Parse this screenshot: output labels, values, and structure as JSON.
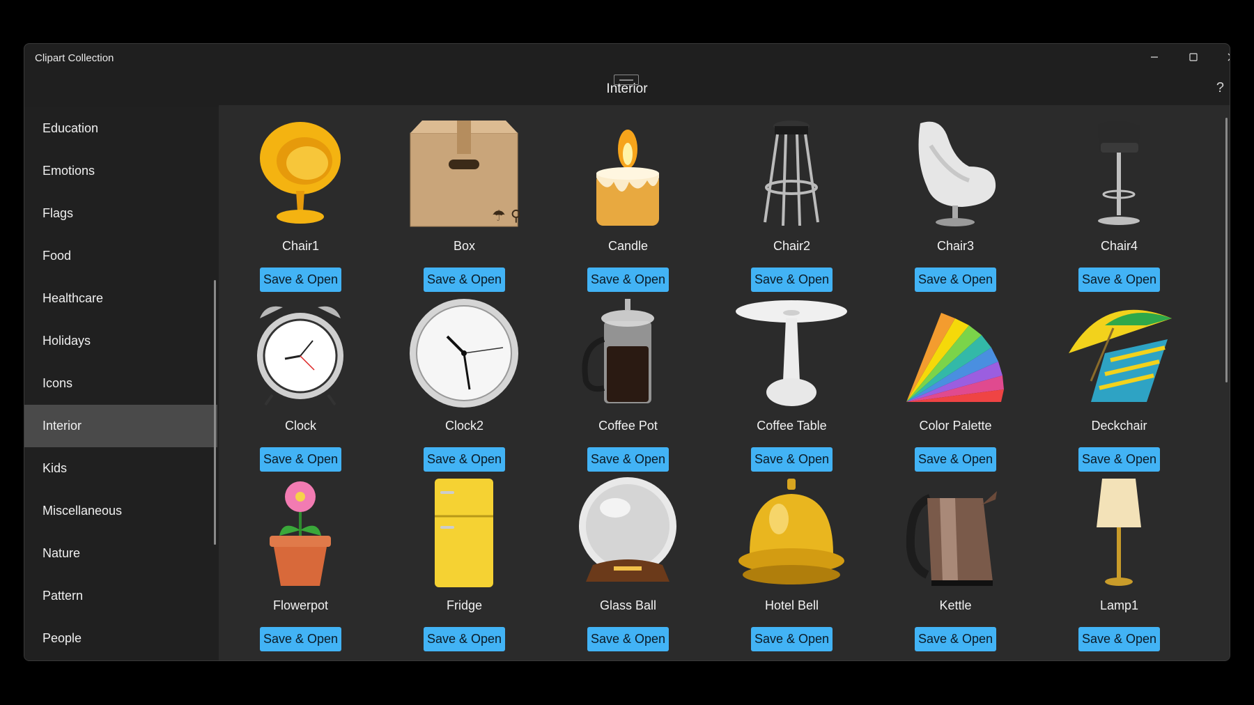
{
  "app": {
    "window_title": "Clipart Collection",
    "category_title": "Interior",
    "help_label": "?"
  },
  "sidebar": {
    "items": [
      {
        "label": "Education"
      },
      {
        "label": "Emotions"
      },
      {
        "label": "Flags"
      },
      {
        "label": "Food"
      },
      {
        "label": "Healthcare"
      },
      {
        "label": "Holidays"
      },
      {
        "label": "Icons"
      },
      {
        "label": "Interior",
        "selected": true
      },
      {
        "label": "Kids"
      },
      {
        "label": "Miscellaneous"
      },
      {
        "label": "Nature"
      },
      {
        "label": "Pattern"
      },
      {
        "label": "People"
      }
    ]
  },
  "grid": {
    "button_label": "Save & Open",
    "items": [
      {
        "name": "Chair1",
        "icon": "chair-icon"
      },
      {
        "name": "Box",
        "icon": "box-icon"
      },
      {
        "name": "Candle",
        "icon": "candle-icon"
      },
      {
        "name": "Chair2",
        "icon": "stool-icon"
      },
      {
        "name": "Chair3",
        "icon": "egg-chair-icon"
      },
      {
        "name": "Chair4",
        "icon": "bar-chair-icon"
      },
      {
        "name": "Clock",
        "icon": "alarm-clock-icon"
      },
      {
        "name": "Clock2",
        "icon": "wall-clock-icon"
      },
      {
        "name": "Coffee Pot",
        "icon": "coffee-pot-icon"
      },
      {
        "name": "Coffee Table",
        "icon": "coffee-table-icon"
      },
      {
        "name": "Color Palette",
        "icon": "color-palette-icon"
      },
      {
        "name": "Deckchair",
        "icon": "deckchair-icon"
      },
      {
        "name": "Flowerpot",
        "icon": "flowerpot-icon"
      },
      {
        "name": "Fridge",
        "icon": "fridge-icon"
      },
      {
        "name": "Glass Ball",
        "icon": "glass-ball-icon"
      },
      {
        "name": "Hotel Bell",
        "icon": "hotel-bell-icon"
      },
      {
        "name": "Kettle",
        "icon": "kettle-icon"
      },
      {
        "name": "Lamp1",
        "icon": "lamp-icon"
      }
    ]
  },
  "colors": {
    "accent": "#42b3f5",
    "content_bg": "#2b2b2b",
    "sidebar_bg": "#202020",
    "selected_bg": "#4a4a4a"
  }
}
